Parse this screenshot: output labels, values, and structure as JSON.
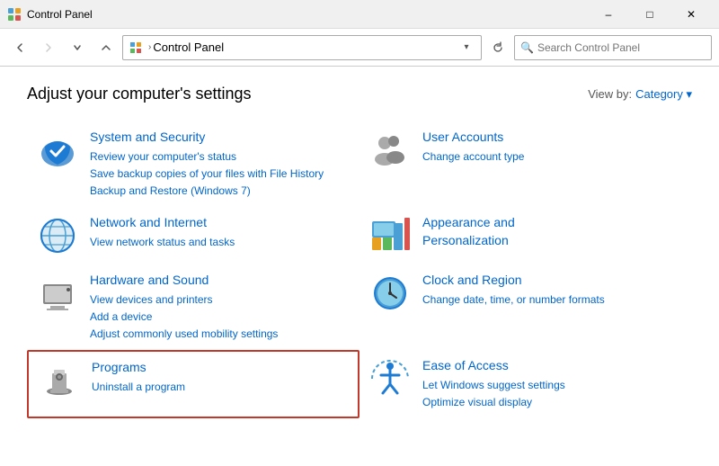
{
  "titleBar": {
    "icon": "control-panel",
    "title": "Control Panel",
    "minimizeLabel": "–",
    "maximizeLabel": "□",
    "closeLabel": "✕"
  },
  "addressBar": {
    "backDisabled": false,
    "forwardDisabled": true,
    "upDisabled": false,
    "breadcrumb": "Control Panel",
    "searchPlaceholder": "Search Control Panel"
  },
  "mainContent": {
    "pageTitle": "Adjust your computer's settings",
    "viewByLabel": "View by:",
    "viewByValue": "Category",
    "categories": [
      {
        "id": "system-security",
        "title": "System and Security",
        "links": [
          "Review your computer's status",
          "Save backup copies of your files with File History",
          "Backup and Restore (Windows 7)"
        ],
        "highlighted": false
      },
      {
        "id": "user-accounts",
        "title": "User Accounts",
        "links": [
          "Change account type"
        ],
        "highlighted": false
      },
      {
        "id": "network-internet",
        "title": "Network and Internet",
        "links": [
          "View network status and tasks"
        ],
        "highlighted": false
      },
      {
        "id": "appearance",
        "title": "Appearance and Personalization",
        "links": [],
        "highlighted": false
      },
      {
        "id": "hardware-sound",
        "title": "Hardware and Sound",
        "links": [
          "View devices and printers",
          "Add a device",
          "Adjust commonly used mobility settings"
        ],
        "highlighted": false
      },
      {
        "id": "clock-region",
        "title": "Clock and Region",
        "links": [
          "Change date, time, or number formats"
        ],
        "highlighted": false
      },
      {
        "id": "programs",
        "title": "Programs",
        "links": [
          "Uninstall a program"
        ],
        "highlighted": true
      },
      {
        "id": "ease-access",
        "title": "Ease of Access",
        "links": [
          "Let Windows suggest settings",
          "Optimize visual display"
        ],
        "highlighted": false
      }
    ]
  }
}
